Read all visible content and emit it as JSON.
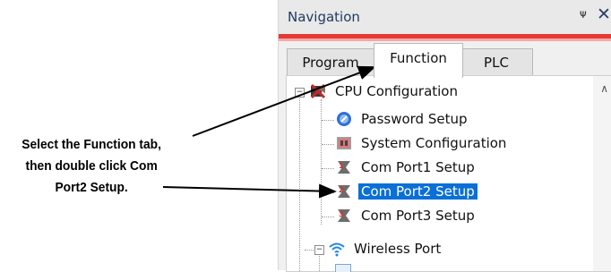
{
  "callout": {
    "lines": [
      "Select the Function tab,",
      "then double click Com",
      "Port2 Setup."
    ]
  },
  "panel": {
    "title": "Navigation",
    "pin_icon": "pin-icon",
    "close_icon": "close-icon",
    "accent_color": "#e53935"
  },
  "tabs": [
    {
      "label": "Program",
      "active": false
    },
    {
      "label": "Function",
      "active": true
    },
    {
      "label": "PLC",
      "active": false
    }
  ],
  "tree": {
    "root": {
      "label": "CPU Configuration",
      "icon": "cpu-configuration-icon",
      "expanded": true
    },
    "items": [
      {
        "label": "Password Setup",
        "icon": "password-icon"
      },
      {
        "label": "System Configuration",
        "icon": "system-configuration-icon"
      },
      {
        "label": "Com Port1 Setup",
        "icon": "com-port-icon"
      },
      {
        "label": "Com Port2 Setup",
        "icon": "com-port-icon",
        "selected": true
      },
      {
        "label": "Com Port3 Setup",
        "icon": "com-port-icon"
      }
    ],
    "wireless": {
      "label": "Wireless Port",
      "icon": "wifi-icon",
      "expanded": true
    }
  },
  "colors": {
    "selection": "#0a6fd6",
    "accent": "#e53935"
  }
}
